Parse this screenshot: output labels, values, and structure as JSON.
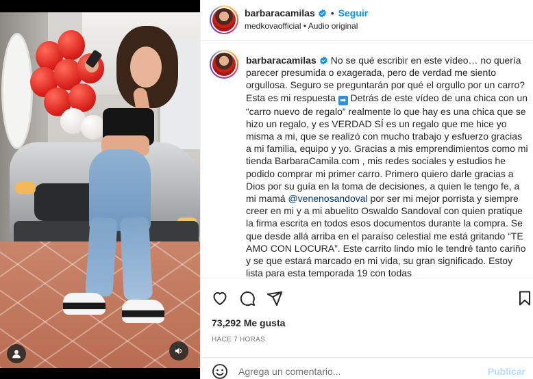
{
  "post": {
    "author": "barbaracamilas",
    "follow_label": "Seguir",
    "dot": "•",
    "subtitle": "medkovaofficial • Audio original"
  },
  "caption": {
    "username": "barbaracamilas",
    "text_before_arrow": "No se qué escribir en este vídeo… no quería parecer presumida o exagerada, pero de verdad me siento orgullosa. Seguro se preguntarán por qué el orgullo por un carro? Esta es mi respuesta",
    "arrow_emoji": "➡",
    "text_after_arrow": "Detrás de este vídeo de una chica con un “carro nuevo de regalo” realmente lo que hay es una chica que se hizo un regalo, y es VERDAD SÍ es un regalo que me hice yo misma a mi, que se realizó con mucho trabajo y esfuerzo gracias a mi familia, equipo y yo. Gracias a mis emprendimientos como mi tienda BarbaraCamila.com , mis redes sociales y estudios he podido comprar mi primer carro. Primero quiero darle gracias a Dios por su guía en la toma de decisiones, a quien le tengo fe, a mi mamá",
    "mention": "@venenosandoval",
    "text_after_mention": "por ser mi mejor porrista y siempre creer en mi y a mi abuelito Oswaldo Sandoval con quien pratique la firma escrita en todos esos documentos durante la compra. Se que desde allá arriba en el paraíso celestial me está gritando “TE AMO CON LOCURA”. Este carrito lindo mío le tendré tanto cariño y se que estará marcado en mi vida, su gran significado. Estoy lista para esta temporada 19 con todas"
  },
  "stats": {
    "likes": "73,292 Me gusta",
    "time_ago": "HACE 7 HORAS"
  },
  "comment_box": {
    "placeholder": "Agrega un comentario...",
    "publish_label": "Publicar"
  },
  "icons": {
    "like": "heart-icon",
    "comment": "comment-icon",
    "share": "share-icon",
    "save": "bookmark-icon",
    "emoji": "emoji-icon",
    "verified": "verified-icon",
    "user_tag": "user-icon",
    "audio": "speaker-icon"
  },
  "colors": {
    "follow": "#0095f6",
    "verified": "#0095f6",
    "publish_disabled": "#b2dffc",
    "mention": "#00376b"
  }
}
